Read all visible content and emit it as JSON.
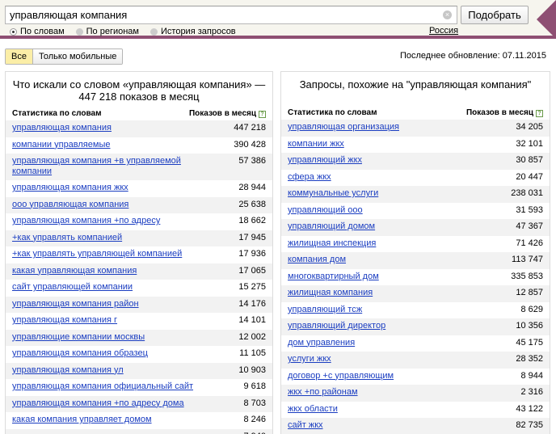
{
  "search": {
    "value": "управляющая компания",
    "submit_label": "Подобрать",
    "clear_glyph": "×",
    "modes": [
      "По словам",
      "По регионам",
      "История запросов"
    ],
    "region": "Россия"
  },
  "filter": {
    "all_label": "Все",
    "mobile_label": "Только мобильные"
  },
  "updated": "Последнее обновление: 07.11.2015",
  "left": {
    "title": "Что искали со словом «управляющая компания» — 447 218 показов в месяц",
    "col_query": "Статистика по словам",
    "col_count": "Показов в месяц",
    "help": "?",
    "rows": [
      {
        "q": "управляющая компания",
        "n": "447 218"
      },
      {
        "q": "компании управляемые",
        "n": "390 428"
      },
      {
        "q": "управляющая компания +в управляемой компании",
        "n": "57 386"
      },
      {
        "q": "управляющая компания жкх",
        "n": "28 944"
      },
      {
        "q": "ооо управляющая компания",
        "n": "25 638"
      },
      {
        "q": "управляющая компания +по адресу",
        "n": "18 662"
      },
      {
        "q": "+как управлять компанией",
        "n": "17 945"
      },
      {
        "q": "+как управлять управляющей компанией",
        "n": "17 936"
      },
      {
        "q": "какая управляющая компания",
        "n": "17 065"
      },
      {
        "q": "сайт управляющей компании",
        "n": "15 275"
      },
      {
        "q": "управляющая компания район",
        "n": "14 176"
      },
      {
        "q": "управляющая компания г",
        "n": "14 101"
      },
      {
        "q": "управляющие компании москвы",
        "n": "12 002"
      },
      {
        "q": "управляющая компания образец",
        "n": "11 105"
      },
      {
        "q": "управляющая компания ул",
        "n": "10 903"
      },
      {
        "q": "управляющая компания официальный сайт",
        "n": "9 618"
      },
      {
        "q": "управляющая компания +по адресу дома",
        "n": "8 703"
      },
      {
        "q": "какая компания управляет домом",
        "n": "8 246"
      },
      {
        "q": "",
        "n": "7 940"
      }
    ]
  },
  "right": {
    "title": "Запросы, похожие на \"управляющая компания\"",
    "col_query": "Статистика по словам",
    "col_count": "Показов в месяц",
    "help": "?",
    "rows": [
      {
        "q": "управляющая организация",
        "n": "34 205"
      },
      {
        "q": "компании жкх",
        "n": "32 101"
      },
      {
        "q": "управляющий жкх",
        "n": "30 857"
      },
      {
        "q": "сфера жкх",
        "n": "20 447"
      },
      {
        "q": "коммунальные услуги",
        "n": "238 031"
      },
      {
        "q": "управляющий ооо",
        "n": "31 593"
      },
      {
        "q": "управляющий домом",
        "n": "47 367"
      },
      {
        "q": "жилищная инспекция",
        "n": "71 426"
      },
      {
        "q": "компания дом",
        "n": "113 747"
      },
      {
        "q": "многоквартирный дом",
        "n": "335 853"
      },
      {
        "q": "жилищная компания",
        "n": "12 857"
      },
      {
        "q": "управляющий тсж",
        "n": "8 629"
      },
      {
        "q": "управляющий директор",
        "n": "10 356"
      },
      {
        "q": "дом управления",
        "n": "45 175"
      },
      {
        "q": "услуги жкх",
        "n": "28 352"
      },
      {
        "q": "договор +с управляющим",
        "n": "8 944"
      },
      {
        "q": "жкх +по районам",
        "n": "2 316"
      },
      {
        "q": "жкх области",
        "n": "43 122"
      },
      {
        "q": "сайт жкх",
        "n": "82 735"
      }
    ]
  }
}
